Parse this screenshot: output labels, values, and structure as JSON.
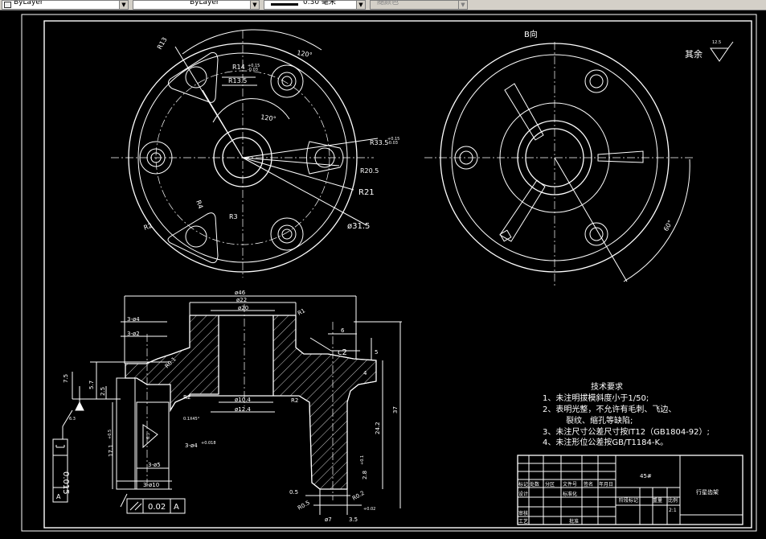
{
  "toolbar": {
    "linetype": "ByLayer",
    "lineweight_value": "ByLayer",
    "lineweight": "0.30 毫米",
    "plotstyle": "随颜色"
  },
  "views": {
    "view_b_label": "B向",
    "surface_note": "其余",
    "surface_value": "12.5"
  },
  "top_view_dims": {
    "r13": "R13",
    "r14": "R14",
    "r13_5": "R13.5",
    "r33_5": "R33.5",
    "r20_5": "R20.5",
    "r21": "R21",
    "d31_5": "ø31.5",
    "r3a": "R3",
    "r3b": "R3",
    "r2": "R2",
    "r4": "R4",
    "a120a": "120°",
    "a120b": "120°",
    "tol_a": "+0.15",
    "tol_b": "-0.03",
    "tol_c": "+0.15",
    "tol_d": "-0.03"
  },
  "b_view_dims": {
    "angle": "60°"
  },
  "section_dims": {
    "d46": "ø46",
    "d22": "ø22",
    "d20": "ø20",
    "r1": "R1",
    "three_d4": "3-ø4",
    "three_d2": "3-ø2",
    "r0_1": "R0.1",
    "d6": "6",
    "c2": "c2",
    "d5": "5",
    "d4": "4",
    "d7_5": "7.5",
    "d5_7": "5.7",
    "d2_5": "2.5",
    "r2a": "R2",
    "r2b": "R2",
    "d10_4": "ø10.4",
    "d12_4": "ø12.4",
    "d37": "37",
    "d24_2": "24.2",
    "d17_1": "17.1",
    "d17_1_tol": "+0.5",
    "d6_3": "6.3",
    "d6_3b": "6.3",
    "ang_note": "0.1X45°",
    "three_d4_tol": "3-ø4",
    "three_d4_tol_val": "+0.018",
    "three_d5": "3-ø5",
    "three_d10": "3-ø10",
    "d0_5": "0.5",
    "d2_8": "2.8",
    "d2_8_tol": "+0.1",
    "d7": "ø7",
    "d7_tol": "+0.02",
    "r0_5": "R0.5",
    "r0_2": "R0.2",
    "d3_5": "3.5",
    "datum_a": "A",
    "flatness": "0.015",
    "flatness_datum": "A",
    "tol_frame": "0.02",
    "tol_frame_datum": "A"
  },
  "tech_requirements": {
    "title": "技术要求",
    "items": [
      "1、未注明拔模斜度小于1/50;",
      "2、表明光整，不允许有毛刺、飞边、",
      "裂纹、缩孔等缺陷;",
      "3、未注尺寸公差尺寸按IT12（GB1804-92）;",
      "4、未注形位公差按GB/T1184-K。"
    ]
  },
  "title_block": {
    "material": "45#",
    "part_name": "行星齿架",
    "row1": [
      "标记",
      "处数",
      "分区",
      "文件号",
      "签名",
      "年月日"
    ],
    "row2": [
      "设计",
      "",
      "标准化"
    ],
    "row3": [
      "审核"
    ],
    "row4": [
      "工艺",
      "",
      "批准"
    ],
    "stage": "阶段标记",
    "weight": "重量",
    "scale": "比例",
    "scale_val": "2:1"
  }
}
